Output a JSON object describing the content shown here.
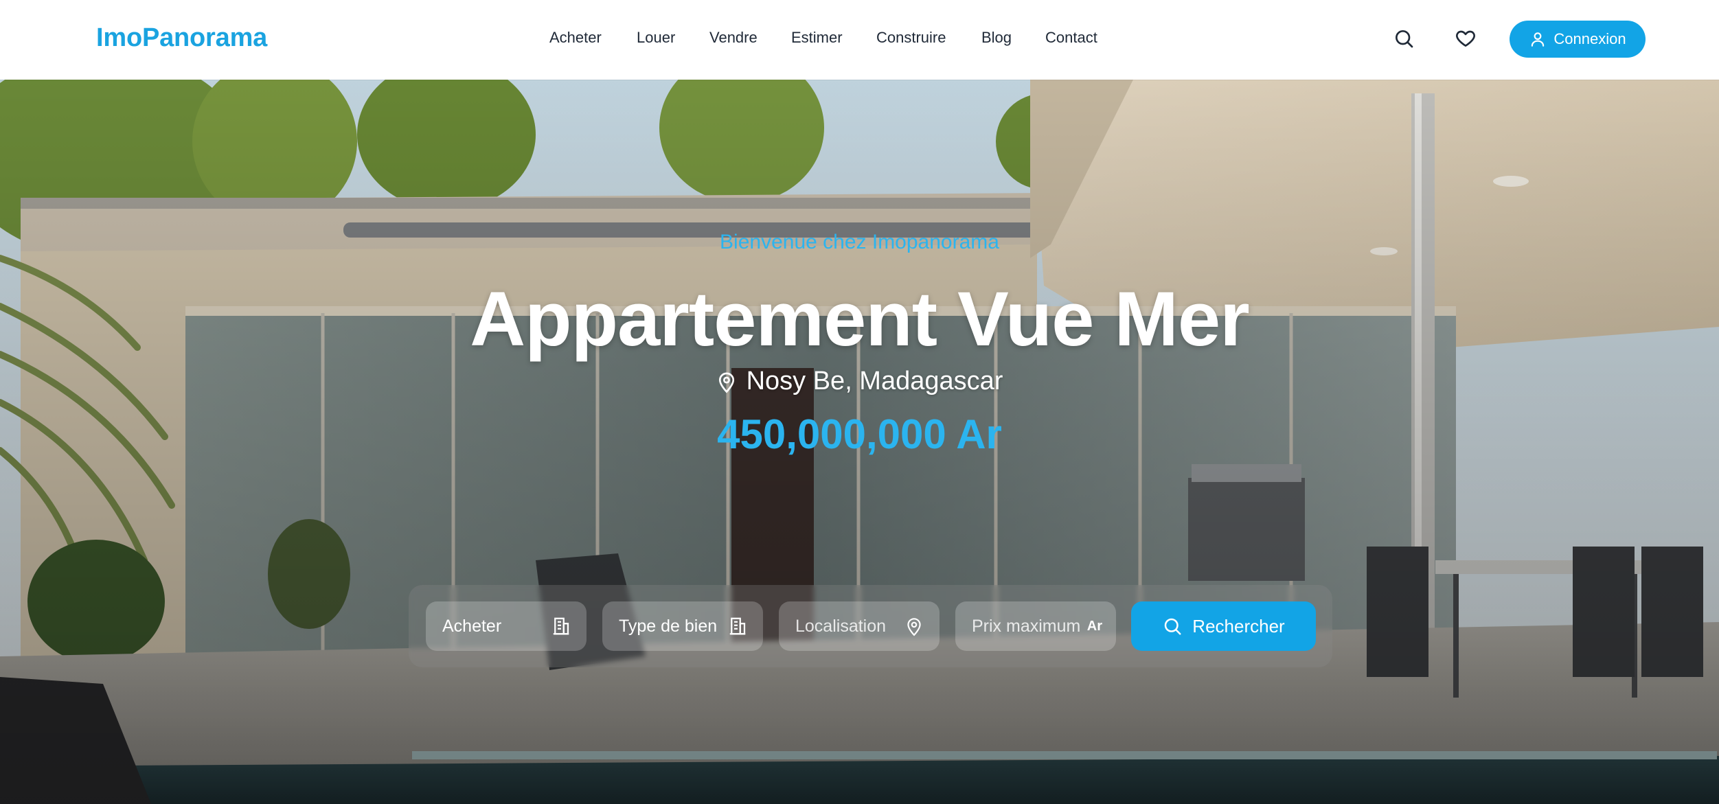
{
  "brand": {
    "name": "ImoPanorama",
    "accent": "#12a4e6"
  },
  "nav": {
    "items": [
      {
        "label": "Acheter"
      },
      {
        "label": "Louer"
      },
      {
        "label": "Vendre"
      },
      {
        "label": "Estimer"
      },
      {
        "label": "Construire"
      },
      {
        "label": "Blog"
      },
      {
        "label": "Contact"
      }
    ],
    "icons": [
      "search-icon",
      "heart-icon"
    ],
    "login_label": "Connexion",
    "login_icon": "user-icon"
  },
  "hero": {
    "welcome": "Bienvenue chez Imopanorama",
    "title": "Appartement Vue Mer",
    "location": "Nosy Be, Madagascar",
    "location_icon": "map-pin-icon",
    "price": "450,000,000 Ar",
    "price_color": "#2bb4ef"
  },
  "search": {
    "transaction": {
      "value": "Acheter",
      "icon": "building-icon"
    },
    "property_type": {
      "value": "Type de bien",
      "icon": "building-icon"
    },
    "location": {
      "placeholder": "Localisation",
      "icon": "map-pin-icon"
    },
    "max_price": {
      "placeholder": "Prix maximum",
      "suffix": "Ar"
    },
    "button_label": "Rechercher",
    "button_icon": "search-icon"
  }
}
